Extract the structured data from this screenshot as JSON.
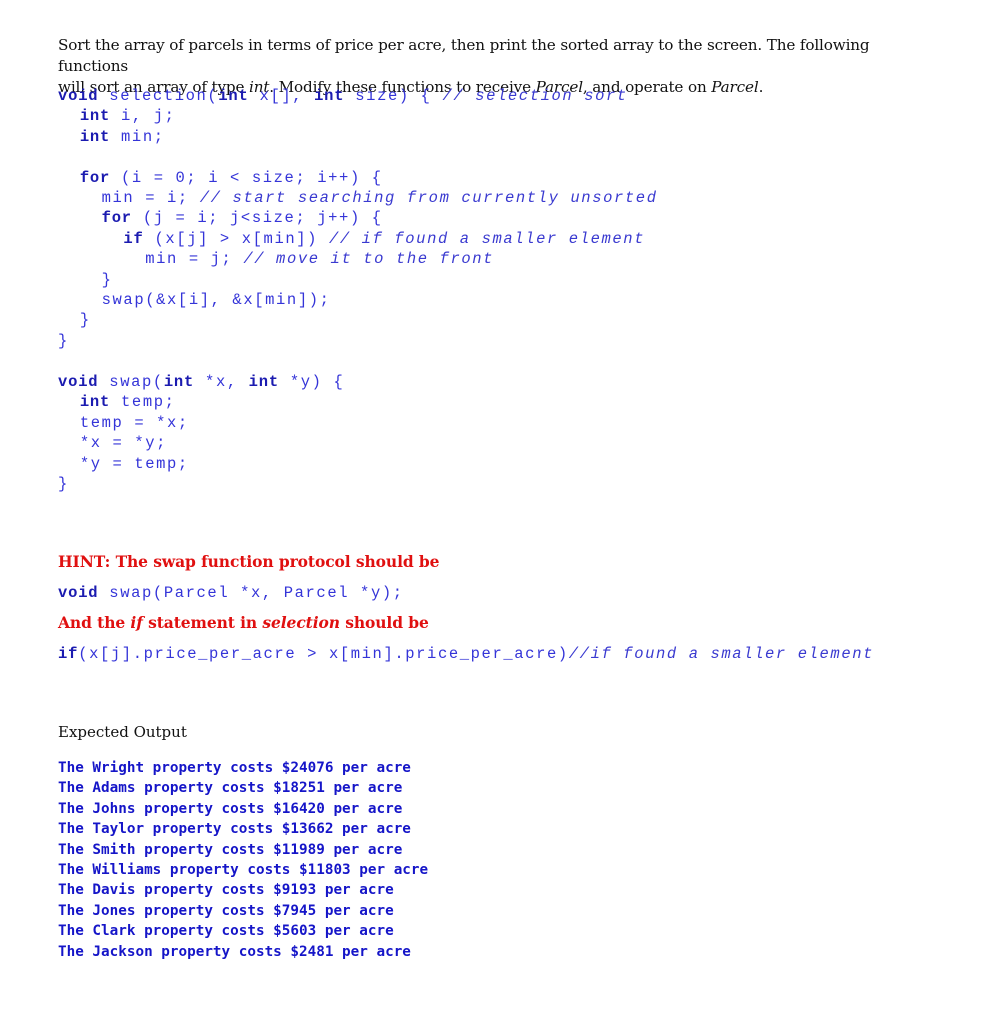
{
  "instructions": {
    "line1": "Sort the array of parcels in terms of price per acre, then print the sorted array to the screen. The following functions",
    "line2_a": "will sort an array of type ",
    "line2_int": "int",
    "line2_b": ". Modify these functions to receive ",
    "line2_parcel1": "Parcel",
    "line2_c": ", and operate on ",
    "line2_parcel2": "Parcel",
    "line2_d": "."
  },
  "selection_code": [
    {
      "indent": "",
      "kw": "void",
      "text": " selection(",
      "kw2": "int",
      "text2": " x[], ",
      "kw3": "int",
      "text3": " size) { ",
      "comment": "// selection sort"
    },
    {
      "indent": "  ",
      "kw": "int",
      "text": " i, j;"
    },
    {
      "indent": "  ",
      "kw": "int",
      "text": " min;"
    },
    {
      "indent": "",
      "text": ""
    },
    {
      "indent": "  ",
      "kw": "for",
      "text": " (i = 0; i < size; i++) {"
    },
    {
      "indent": "    ",
      "text": "min = i; ",
      "comment": "// start searching from currently unsorted"
    },
    {
      "indent": "    ",
      "kw": "for",
      "text": " (j = i; j<size; j++) {"
    },
    {
      "indent": "      ",
      "kw": "if",
      "text": " (x[j] > x[min]) ",
      "comment": "// if found a smaller element"
    },
    {
      "indent": "        ",
      "text": "min = j; ",
      "comment": "// move it to the front"
    },
    {
      "indent": "    ",
      "text": "}"
    },
    {
      "indent": "    ",
      "text": "swap(&x[i], &x[min]);"
    },
    {
      "indent": "  ",
      "text": "}"
    },
    {
      "indent": "",
      "text": "}"
    }
  ],
  "swap_code": [
    {
      "indent": "",
      "kw": "void",
      "text": " swap(",
      "kw2": "int",
      "text2": " *x, ",
      "kw3": "int",
      "text3": " *y) {"
    },
    {
      "indent": "  ",
      "kw": "int",
      "text": " temp;"
    },
    {
      "indent": "  ",
      "text": "temp = *x;"
    },
    {
      "indent": "  ",
      "text": "*x = *y;"
    },
    {
      "indent": "  ",
      "text": "*y = temp;"
    },
    {
      "indent": "",
      "text": "}"
    }
  ],
  "hint": {
    "line1": "HINT: The swap function protocol should be",
    "swap_kw": "void",
    "swap_text": " swap(Parcel *x, Parcel *y);",
    "line2_a": "And the ",
    "line2_if": "if",
    "line2_b": " statement in ",
    "line2_selection": "selection",
    "line2_c": " should be",
    "if_kw": "if",
    "if_text": "(x[j].price_per_acre > x[min].price_per_acre)",
    "if_comment": "//if found a smaller element"
  },
  "expected_output": {
    "heading": "Expected Output",
    "lines": [
      "The Wright property costs $24076 per acre",
      "The Adams property costs $18251 per acre",
      "The Johns property costs $16420 per acre",
      "The Taylor property costs $13662 per acre",
      "The Smith property costs $11989 per acre",
      "The Williams property costs $11803 per acre",
      "The Davis property costs $9193 per acre",
      "The Jones property costs $7945 per acre",
      "The Clark property costs $5603 per acre",
      "The Jackson property costs $2481 per acre"
    ]
  }
}
